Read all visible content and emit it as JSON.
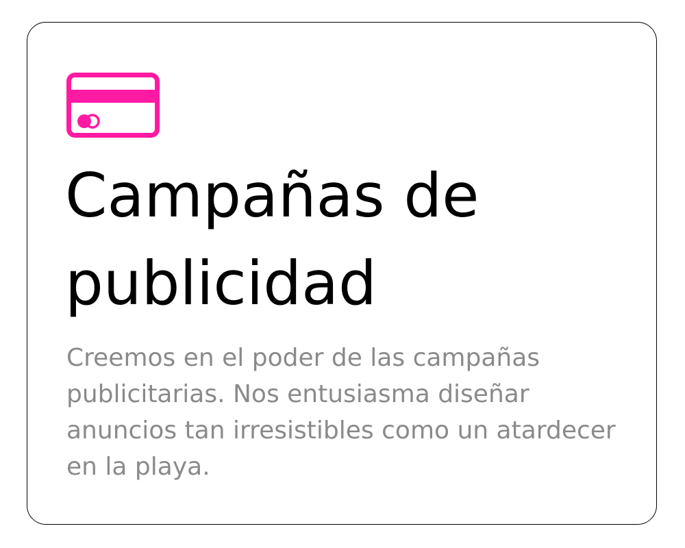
{
  "card": {
    "icon": "credit-card-icon",
    "icon_color": "#ff1aa3",
    "title": "Campañas de publicidad",
    "description": "Creemos en el poder de las campañas publicitarias. Nos entusiasma diseñar anuncios tan irresistibles como un atardecer en la playa."
  },
  "colors": {
    "title": "#000000",
    "description": "#8a8a8a",
    "border": "#000000",
    "accent": "#ff1aa3"
  }
}
